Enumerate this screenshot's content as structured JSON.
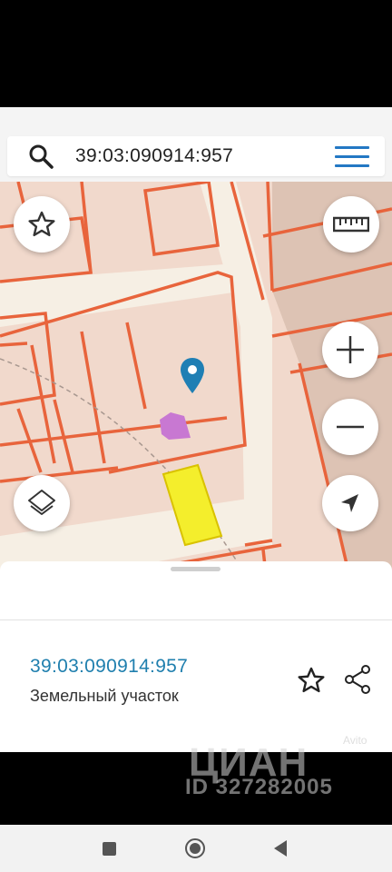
{
  "search": {
    "query": "39:03:090914:957",
    "search_icon": "search-icon",
    "menu_icon": "hamburger-menu-icon"
  },
  "map": {
    "controls": {
      "favorite_icon": "star-outline-icon",
      "ruler_icon": "ruler-icon",
      "zoom_in_icon": "plus-icon",
      "zoom_out_icon": "minus-icon",
      "layers_icon": "layers-icon",
      "location_icon": "navigation-arrow-icon"
    },
    "marker_icon": "location-pin-icon",
    "colors": {
      "parcel_line": "#e8643c",
      "background": "#f1d9cc",
      "selected_parcel": "#f4ee2c",
      "building": "#c878d2",
      "marker": "#1f7fb4",
      "road": "#f6efe4"
    }
  },
  "sheet": {
    "parcel_id": "39:03:090914:957",
    "parcel_type": "Земельный участок",
    "favorite_icon": "star-outline-icon",
    "share_icon": "share-icon"
  },
  "watermark": {
    "brand": "ЦИАН",
    "id_text": "ID 327282005",
    "avito": "Avito"
  },
  "android_nav": {
    "recents_icon": "square-icon",
    "home_icon": "circle-icon",
    "back_icon": "triangle-back-icon"
  }
}
